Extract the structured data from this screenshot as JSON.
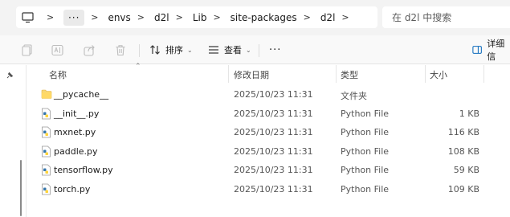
{
  "address_bar": {
    "more_label": "···",
    "path": [
      "envs",
      "d2l",
      "Lib",
      "site-packages",
      "d2l"
    ],
    "separator": ">",
    "search_placeholder": "在 d2l 中搜索"
  },
  "command_bar": {
    "sort_label": "排序",
    "view_label": "查看",
    "more_label": "···",
    "details_label": "详细信"
  },
  "columns": {
    "name": "名称",
    "date": "修改日期",
    "type": "类型",
    "size": "大小"
  },
  "files": [
    {
      "name": "__pycache__",
      "date": "2025/10/23 11:31",
      "type": "文件夹",
      "size": "",
      "icon": "folder-icon"
    },
    {
      "name": "__init__.py",
      "date": "2025/10/23 11:31",
      "type": "Python File",
      "size": "1 KB",
      "icon": "python-file-icon"
    },
    {
      "name": "mxnet.py",
      "date": "2025/10/23 11:31",
      "type": "Python File",
      "size": "116 KB",
      "icon": "python-file-icon"
    },
    {
      "name": "paddle.py",
      "date": "2025/10/23 11:31",
      "type": "Python File",
      "size": "108 KB",
      "icon": "python-file-icon"
    },
    {
      "name": "tensorflow.py",
      "date": "2025/10/23 11:31",
      "type": "Python File",
      "size": "59 KB",
      "icon": "python-file-icon"
    },
    {
      "name": "torch.py",
      "date": "2025/10/23 11:31",
      "type": "Python File",
      "size": "109 KB",
      "icon": "python-file-icon"
    }
  ]
}
